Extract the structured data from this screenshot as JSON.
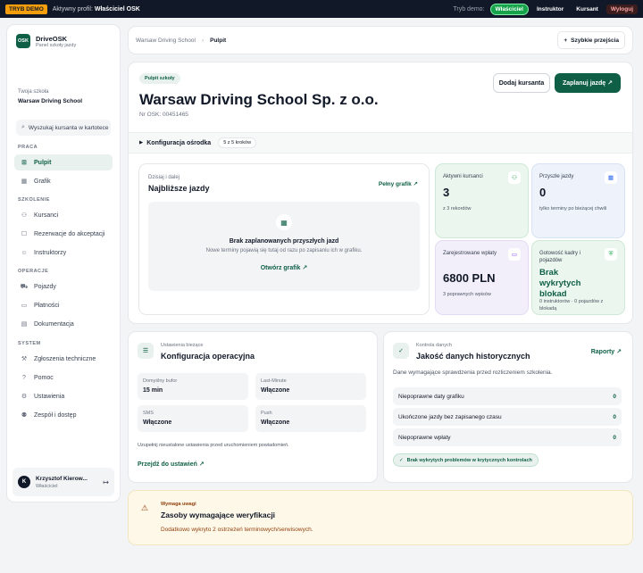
{
  "topbar": {
    "demo_badge": "TRYB DEMO",
    "profile_label": "Aktywny profil:",
    "profile_value": "Właściciel OSK",
    "mode_label": "Tryb demo:",
    "modes": [
      "Właściciel",
      "Instruktor",
      "Kursant"
    ],
    "logout": "Wyloguj"
  },
  "sidebar": {
    "brand_logo": "OSK",
    "brand_name": "DriveOSK",
    "brand_sub": "Panel szkoły jazdy",
    "school_label": "Twoja szkoła",
    "school_name": "Warsaw Driving School",
    "search_placeholder": "Wyszukaj kursanta w kartotece",
    "sections": {
      "praca": "PRACA",
      "szkolenie": "SZKOLENIE",
      "operacje": "OPERACJE",
      "system": "SYSTEM"
    },
    "items": [
      "Pulpit",
      "Grafik",
      "Kursanci",
      "Rezerwacje do akceptacji",
      "Instruktorzy",
      "Pojazdy",
      "Płatności",
      "Dokumentacja",
      "Zgłoszenia techniczne",
      "Pomoc",
      "Ustawienia",
      "Zespół i dostęp"
    ],
    "user_initial": "K",
    "user_name": "Krzysztof Kierow...",
    "user_role": "Właściciel"
  },
  "header": {
    "crumb_root": "Warsaw Driving School",
    "crumb_current": "Pulpit",
    "quick_actions": "Szybkie przejścia"
  },
  "main": {
    "pill": "Pulpit szkoły",
    "title": "Warsaw Driving School Sp. z o.o.",
    "osk_nr": "Nr OSK: 00451465",
    "add_student": "Dodaj kursanta",
    "plan_drive": "Zaplanuj jazdę",
    "config_label": "Konfiguracja ośrodka",
    "config_steps": "5 z 5 kroków",
    "schedule": {
      "sub": "Dzisiaj i dalej",
      "title": "Najbliższe jazdy",
      "full_link": "Pełny grafik",
      "empty_title": "Brak zaplanowanych przyszłych jazd",
      "empty_sub": "Nowe terminy pojawią się tutaj od razu po zapisaniu ich w grafiku.",
      "open_link": "Otwórz grafik"
    },
    "stats": {
      "active_label": "Aktywni kursanci",
      "active_value": "3",
      "active_foot": "z 3 rekordów",
      "future_label": "Przyszłe jazdy",
      "future_value": "0",
      "future_foot": "tylko terminy po bieżącej chwili",
      "payments_label": "Zarejestrowane wpłaty",
      "payments_value": "6800 PLN",
      "payments_foot": "3 poprawnych wpisów",
      "ready_label": "Gotowość kadry i pojazdów",
      "ready_value": "Brak wykrytych blokad",
      "ready_foot": "0 instruktorów · 0 pojazdów z blokadą"
    }
  },
  "settings_card": {
    "sub": "Ustawienia bieżące",
    "title": "Konfiguracja operacyjna",
    "tiles": [
      {
        "k": "Domyślny bufor",
        "v": "15 min"
      },
      {
        "k": "Last-Minute",
        "v": "Włączone"
      },
      {
        "k": "SMS",
        "v": "Włączone"
      },
      {
        "k": "Push",
        "v": "Włączone"
      }
    ],
    "note": "Uzupełnij nieustalone ustawienia przed uruchomieniem powiadomień.",
    "go_link": "Przejdź do ustawień"
  },
  "quality_card": {
    "sub": "Kontrola danych",
    "title": "Jakość danych historycznych",
    "link": "Raporty",
    "desc": "Dane wymagające sprawdzenia przed rozliczeniem szkolenia.",
    "rows": [
      {
        "label": "Niepoprawne daty grafiku",
        "count": "0"
      },
      {
        "label": "Ukończone jazdy bez zapisanego czasu",
        "count": "0"
      },
      {
        "label": "Niepoprawne wpłaty",
        "count": "0"
      }
    ],
    "badge": "Brak wykrytych problemów w krytycznych kontrolach"
  },
  "warning": {
    "sub": "Wymaga uwagi",
    "title": "Zasoby wymagające weryfikacji",
    "text": "Dodatkowo wykryto 2 ostrzeżeń terminowych/serwisowych."
  }
}
